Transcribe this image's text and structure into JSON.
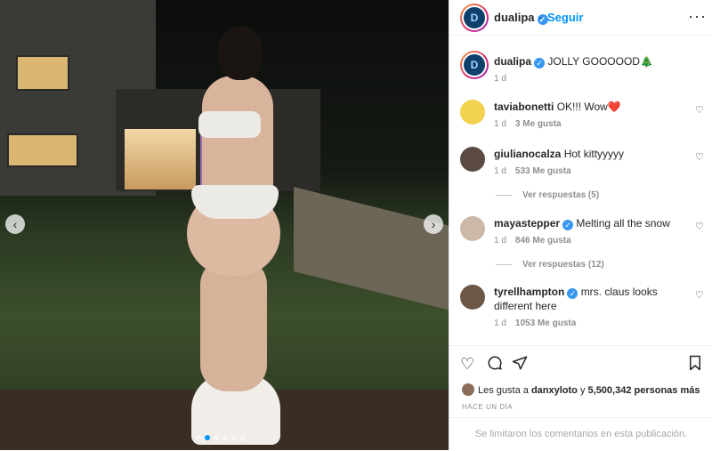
{
  "post": {
    "author": "dualipa",
    "verified": true,
    "follow_label": "Seguir",
    "more_icon": "more-horizontal-icon",
    "caption_text": "JOLLY GOOOOOD🎄",
    "caption_age": "1 d",
    "carousel_dots": 6,
    "carousel_active": 1
  },
  "comments": [
    {
      "user": "taviabonetti",
      "verified": false,
      "text": "OK!!! Wow❤️",
      "age": "1 d",
      "likes": "3 Me gusta",
      "replies": ""
    },
    {
      "user": "giulianocalza",
      "verified": false,
      "text": "Hot kittyyyyy",
      "age": "1 d",
      "likes": "533 Me gusta",
      "replies": "Ver respuestas (5)"
    },
    {
      "user": "mayastepper",
      "verified": true,
      "text": "Melting all the snow",
      "age": "1 d",
      "likes": "846 Me gusta",
      "replies": "Ver respuestas (12)"
    },
    {
      "user": "tyrellhampton",
      "verified": true,
      "text": "mrs. claus looks different here",
      "age": "1 d",
      "likes": "1053 Me gusta",
      "replies": ""
    }
  ],
  "actions": {
    "like_icon": "heart-icon",
    "comment_icon": "comment-icon",
    "share_icon": "share-icon",
    "save_icon": "bookmark-icon",
    "likes_prefix": "Les gusta a",
    "likes_user": "danxyloto",
    "likes_joiner": "y",
    "likes_count": "5,500,342 personas más",
    "age": "HACE UN DÍA",
    "limited_notice": "Se limitaron los comentarios en esta publicación."
  }
}
